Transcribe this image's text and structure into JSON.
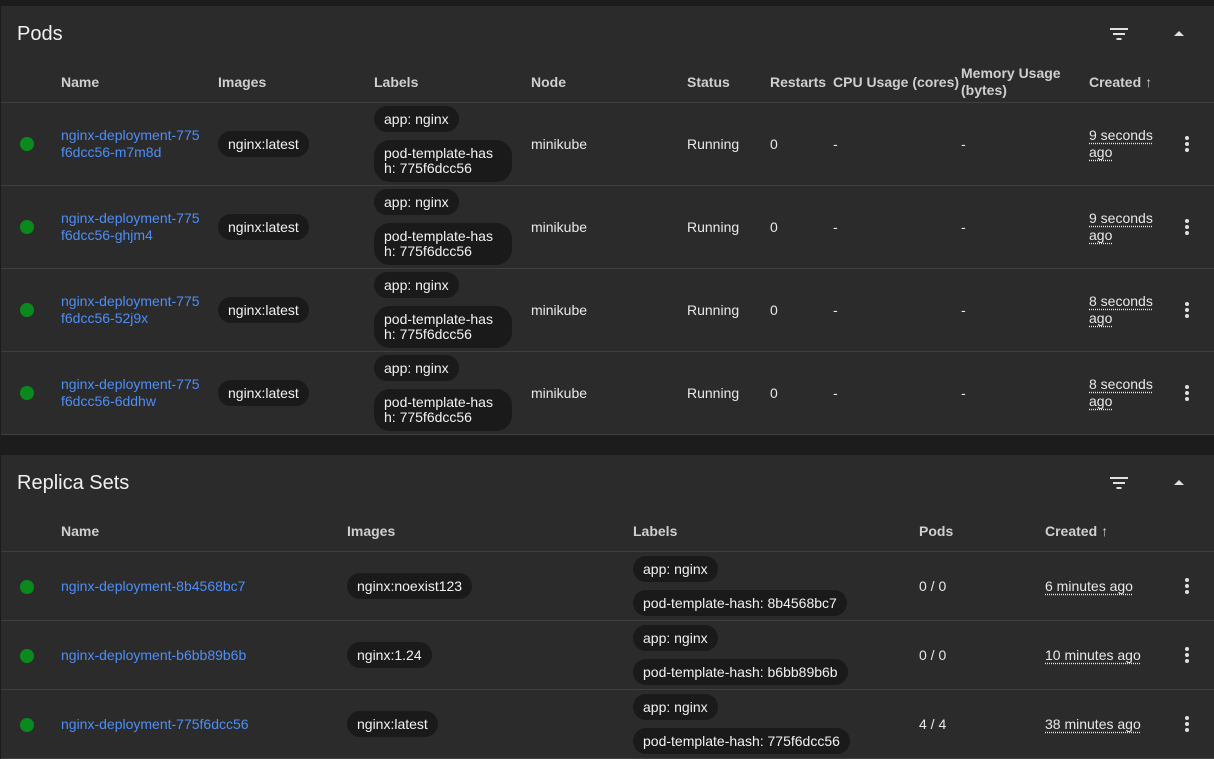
{
  "pods": {
    "title": "Pods",
    "columns": {
      "name": "Name",
      "images": "Images",
      "labels": "Labels",
      "node": "Node",
      "status": "Status",
      "restarts": "Restarts",
      "cpu": "CPU Usage (cores)",
      "memory": "Memory Usage (bytes)",
      "created": "Created"
    },
    "sort_arrow": "↑",
    "rows": [
      {
        "name": "nginx-deployment-775f6dcc56-m7m8d",
        "image": "nginx:latest",
        "label1": "app: nginx",
        "label2": "pod-template-hash: 775f6dcc56",
        "node": "minikube",
        "status": "Running",
        "restarts": "0",
        "cpu": "-",
        "memory": "-",
        "created": "9 seconds ago",
        "status_color": "#0a8a1c"
      },
      {
        "name": "nginx-deployment-775f6dcc56-ghjm4",
        "image": "nginx:latest",
        "label1": "app: nginx",
        "label2": "pod-template-hash: 775f6dcc56",
        "node": "minikube",
        "status": "Running",
        "restarts": "0",
        "cpu": "-",
        "memory": "-",
        "created": "9 seconds ago",
        "status_color": "#0a8a1c"
      },
      {
        "name": "nginx-deployment-775f6dcc56-52j9x",
        "image": "nginx:latest",
        "label1": "app: nginx",
        "label2": "pod-template-hash: 775f6dcc56",
        "node": "minikube",
        "status": "Running",
        "restarts": "0",
        "cpu": "-",
        "memory": "-",
        "created": "8 seconds ago",
        "status_color": "#0a8a1c"
      },
      {
        "name": "nginx-deployment-775f6dcc56-6ddhw",
        "image": "nginx:latest",
        "label1": "app: nginx",
        "label2": "pod-template-hash: 775f6dcc56",
        "node": "minikube",
        "status": "Running",
        "restarts": "0",
        "cpu": "-",
        "memory": "-",
        "created": "8 seconds ago",
        "status_color": "#0a8a1c"
      }
    ]
  },
  "replica_sets": {
    "title": "Replica Sets",
    "columns": {
      "name": "Name",
      "images": "Images",
      "labels": "Labels",
      "pods": "Pods",
      "created": "Created"
    },
    "sort_arrow": "↑",
    "rows": [
      {
        "name": "nginx-deployment-8b4568bc7",
        "image": "nginx:noexist123",
        "label1": "app: nginx",
        "label2": "pod-template-hash: 8b4568bc7",
        "pods": "0 / 0",
        "created": "6 minutes ago",
        "status_color": "#0a8a1c"
      },
      {
        "name": "nginx-deployment-b6bb89b6b",
        "image": "nginx:1.24",
        "label1": "app: nginx",
        "label2": "pod-template-hash: b6bb89b6b",
        "pods": "0 / 0",
        "created": "10 minutes ago",
        "status_color": "#0a8a1c"
      },
      {
        "name": "nginx-deployment-775f6dcc56",
        "image": "nginx:latest",
        "label1": "app: nginx",
        "label2": "pod-template-hash: 775f6dcc56",
        "pods": "4 / 4",
        "created": "38 minutes ago",
        "status_color": "#0a8a1c"
      }
    ]
  },
  "icons": {
    "filter": "filter-icon",
    "collapse": "chevron-up-icon",
    "more": "more-vert-icon",
    "status": "status-dot-icon"
  }
}
